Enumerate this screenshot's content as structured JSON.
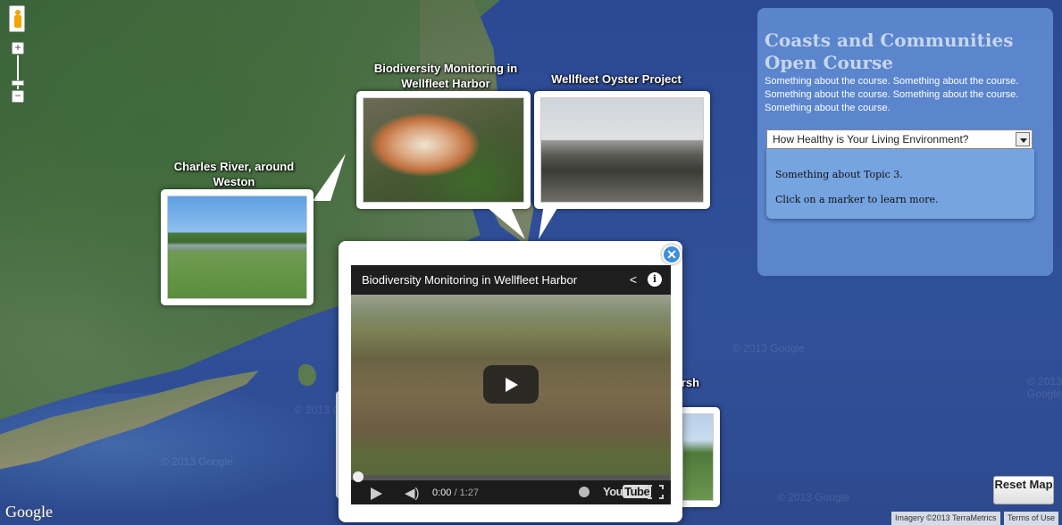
{
  "markers": [
    {
      "label": "Charles River, around Weston",
      "image": "charles-river-photo"
    },
    {
      "label": "Biodiversity Monitoring in Wellfleet Harbor",
      "image": "shell-photo"
    },
    {
      "label": "Wellfleet Oyster Project",
      "image": "oyster-farm-photo"
    },
    {
      "label": "larsh",
      "image": "marsh-photo"
    }
  ],
  "video": {
    "title": "Biodiversity Monitoring in Wellfleet Harbor",
    "current_time": "0:00",
    "duration": "/ 1:27",
    "progress": 0,
    "youtube_label": "You",
    "youtube_label_2": "Tube"
  },
  "panel": {
    "title": "Coasts and Communities Open Course",
    "description": "Something about the course. Something about the course. Something about the course. Something about the course. Something about the course.",
    "selected_topic": "How Healthy is Your Living Environment?",
    "topic_text": "Something about Topic 3.",
    "instruction": "Click on a marker to learn more."
  },
  "map": {
    "watermark": "© 2013 Google",
    "logo": "Google",
    "imagery": "Imagery ©2013 TerraMetrics",
    "terms": "Terms of Use",
    "zoom_in": "+",
    "zoom_out": "−"
  },
  "reset_button": "Reset Map",
  "colors": {
    "panel_bg": "#6896dc",
    "close_button": "#3e8fd6",
    "map_water": "#2f4b8c"
  }
}
